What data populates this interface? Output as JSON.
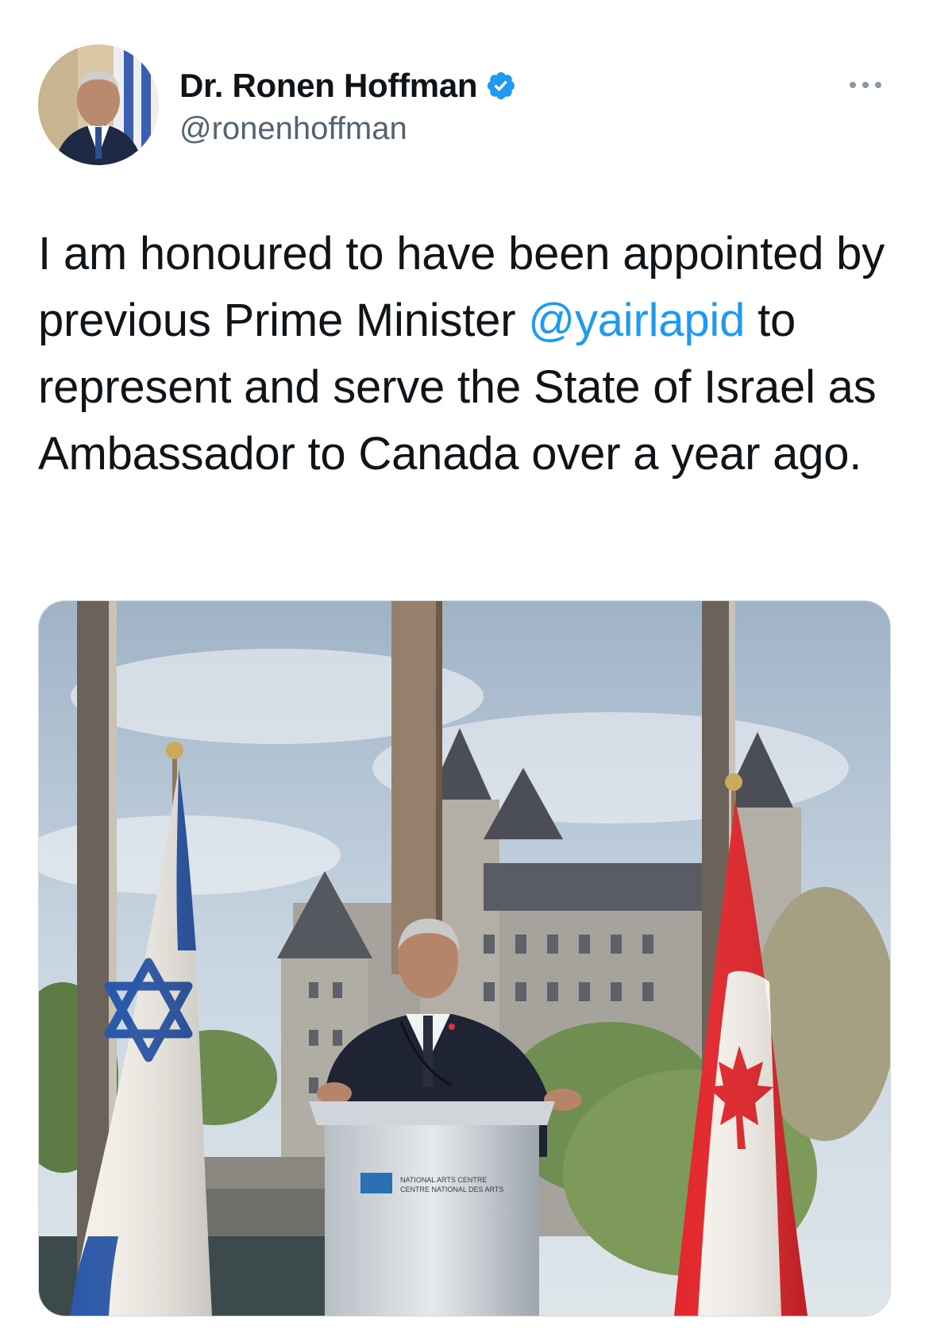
{
  "author": {
    "display_name": "Dr. Ronen Hoffman",
    "handle": "@ronenhoffman",
    "verified": true,
    "verified_icon": "verified-badge-icon",
    "accent_color": "#1d9bf0"
  },
  "menu": {
    "icon": "more-options-icon"
  },
  "tweet": {
    "text_before_mention": "I am honoured to have been appointed by previous Prime Minister ",
    "mention": "@yairlapid",
    "text_after_mention": " to represent and serve the State of Israel as Ambassador to Canada over a year ago."
  },
  "media": {
    "podium_sign_line1": "NATIONAL ARTS CENTRE",
    "podium_sign_line2": "CENTRE NATIONAL DES ARTS"
  }
}
